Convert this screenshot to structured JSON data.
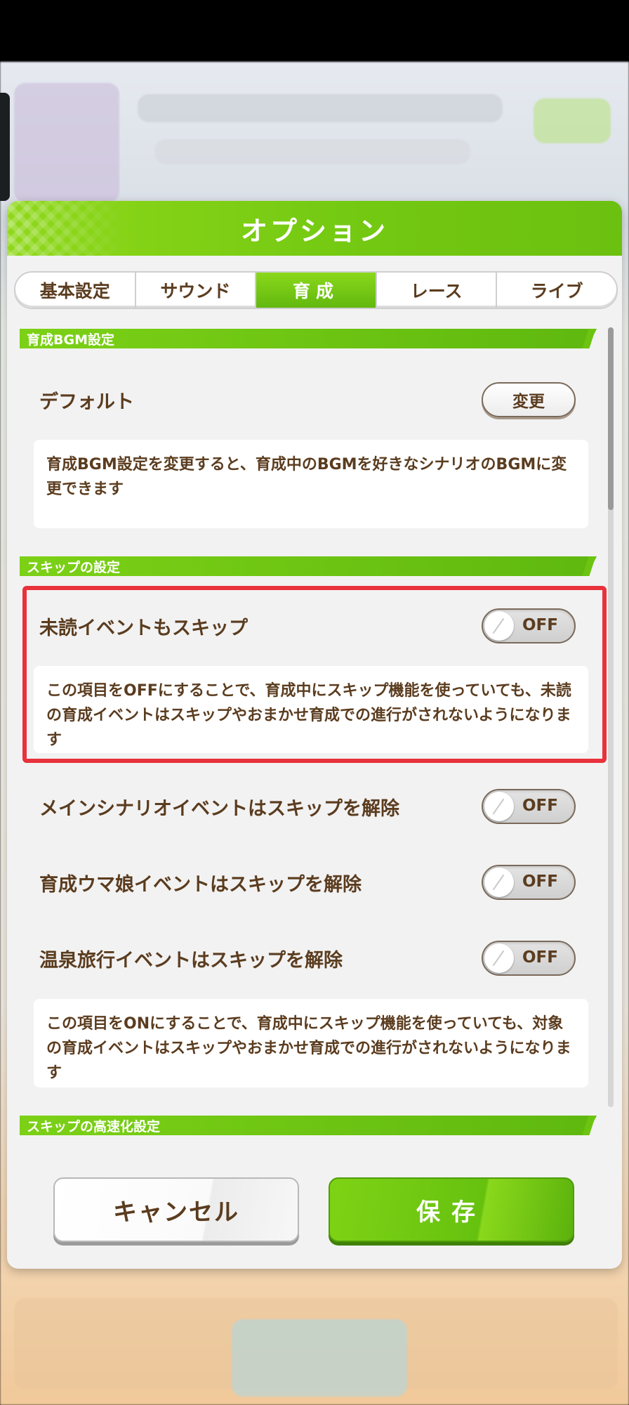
{
  "dialog": {
    "title": "オプション"
  },
  "tabs": [
    {
      "label": "基本設定"
    },
    {
      "label": "サウンド"
    },
    {
      "label": "育成",
      "active": true
    },
    {
      "label": "レース"
    },
    {
      "label": "ライブ"
    }
  ],
  "sections": {
    "bgm": {
      "title": "育成BGM設定",
      "row_label": "デフォルト",
      "change_button": "変更",
      "description": "育成BGM設定を変更すると、育成中のBGMを好きなシナリオのBGMに変更できます"
    },
    "skip": {
      "title": "スキップの設定",
      "unread_label": "未読イベントもスキップ",
      "unread_toggle": "OFF",
      "unread_description": "この項目をOFFにすることで、育成中にスキップ機能を使っていても、未読の育成イベントはスキップやおまかせ育成での進行がされないようになります",
      "main_scenario_label": "メインシナリオイベントはスキップを解除",
      "main_scenario_toggle": "OFF",
      "uma_event_label": "育成ウマ娘イベントはスキップを解除",
      "uma_event_toggle": "OFF",
      "onsen_label": "温泉旅行イベントはスキップを解除",
      "onsen_toggle": "OFF",
      "release_description": "この項目をONにすることで、育成中にスキップ機能を使っていても、対象の育成イベントはスキップやおまかせ育成での進行がされないようになります"
    },
    "speed": {
      "title": "スキップの高速化設定"
    }
  },
  "buttons": {
    "cancel": "キャンセル",
    "save": "保存"
  },
  "colors": {
    "accent_green": "#6cc010",
    "text_brown": "#5b3c1f",
    "highlight_red": "#e8323c"
  }
}
